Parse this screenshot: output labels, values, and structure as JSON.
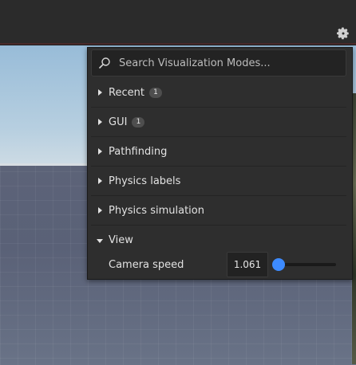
{
  "search": {
    "placeholder": "Search Visualization Modes..."
  },
  "groups": [
    {
      "label": "Recent",
      "badge": "1",
      "expanded": false
    },
    {
      "label": "GUI",
      "badge": "1",
      "expanded": false
    },
    {
      "label": "Pathfinding",
      "badge": "",
      "expanded": false
    },
    {
      "label": "Physics labels",
      "badge": "",
      "expanded": false
    },
    {
      "label": "Physics simulation",
      "badge": "",
      "expanded": false
    },
    {
      "label": "View",
      "badge": "",
      "expanded": true
    }
  ],
  "view_settings": {
    "camera_speed_label": "Camera speed",
    "camera_speed_value": "1.061",
    "camera_speed_slider_fraction": 0.0
  },
  "icons": {
    "toolbar": "gear-icon",
    "search": "search-icon",
    "collapsed": "caret-right-icon",
    "expanded": "caret-down-icon"
  },
  "colors": {
    "panel_bg": "#2e2e2e",
    "accent": "#3d8bff",
    "text": "#e2e2e2",
    "badge_bg": "#4e4e4e"
  }
}
